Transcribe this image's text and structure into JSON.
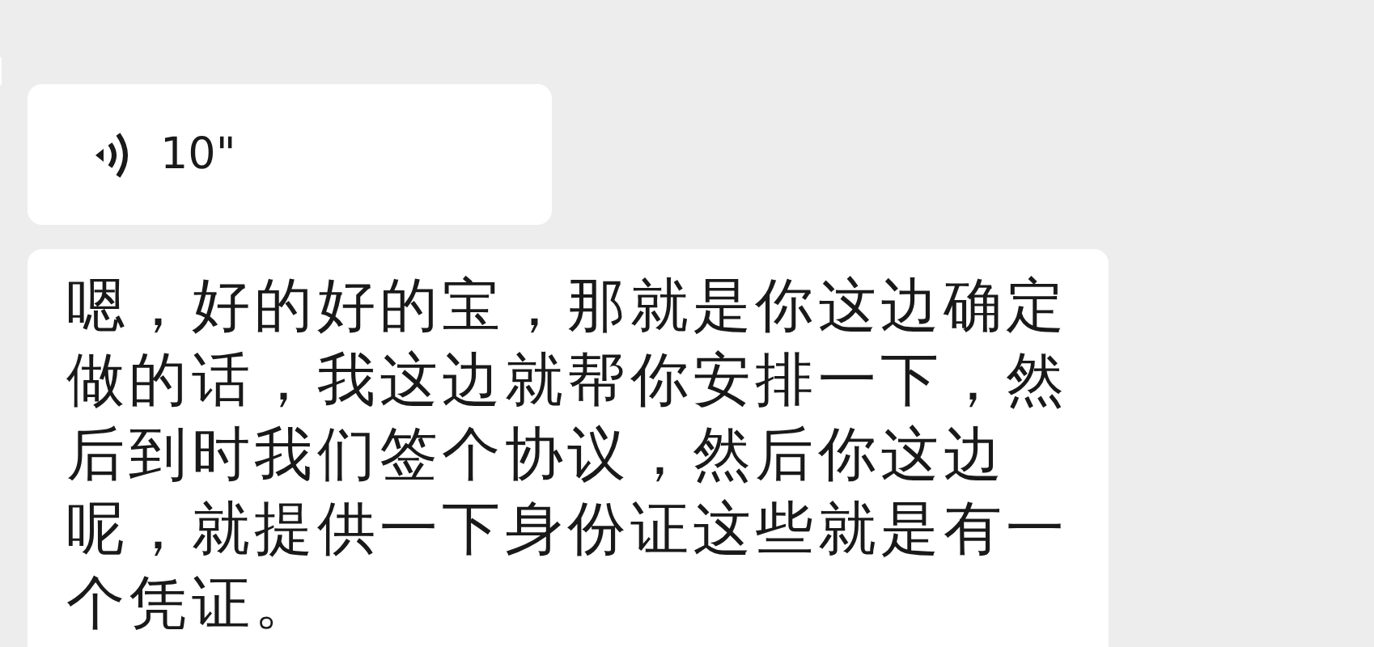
{
  "messages": [
    {
      "kind": "voice",
      "duration": "10\""
    },
    {
      "kind": "text",
      "text": "嗯，好的好的宝，那就是你这边确定做的话，我这边就帮你安排一下，然后到时我们签个协议，然后你这边呢，就提供一下身份证这些就是有一个凭证。"
    }
  ]
}
